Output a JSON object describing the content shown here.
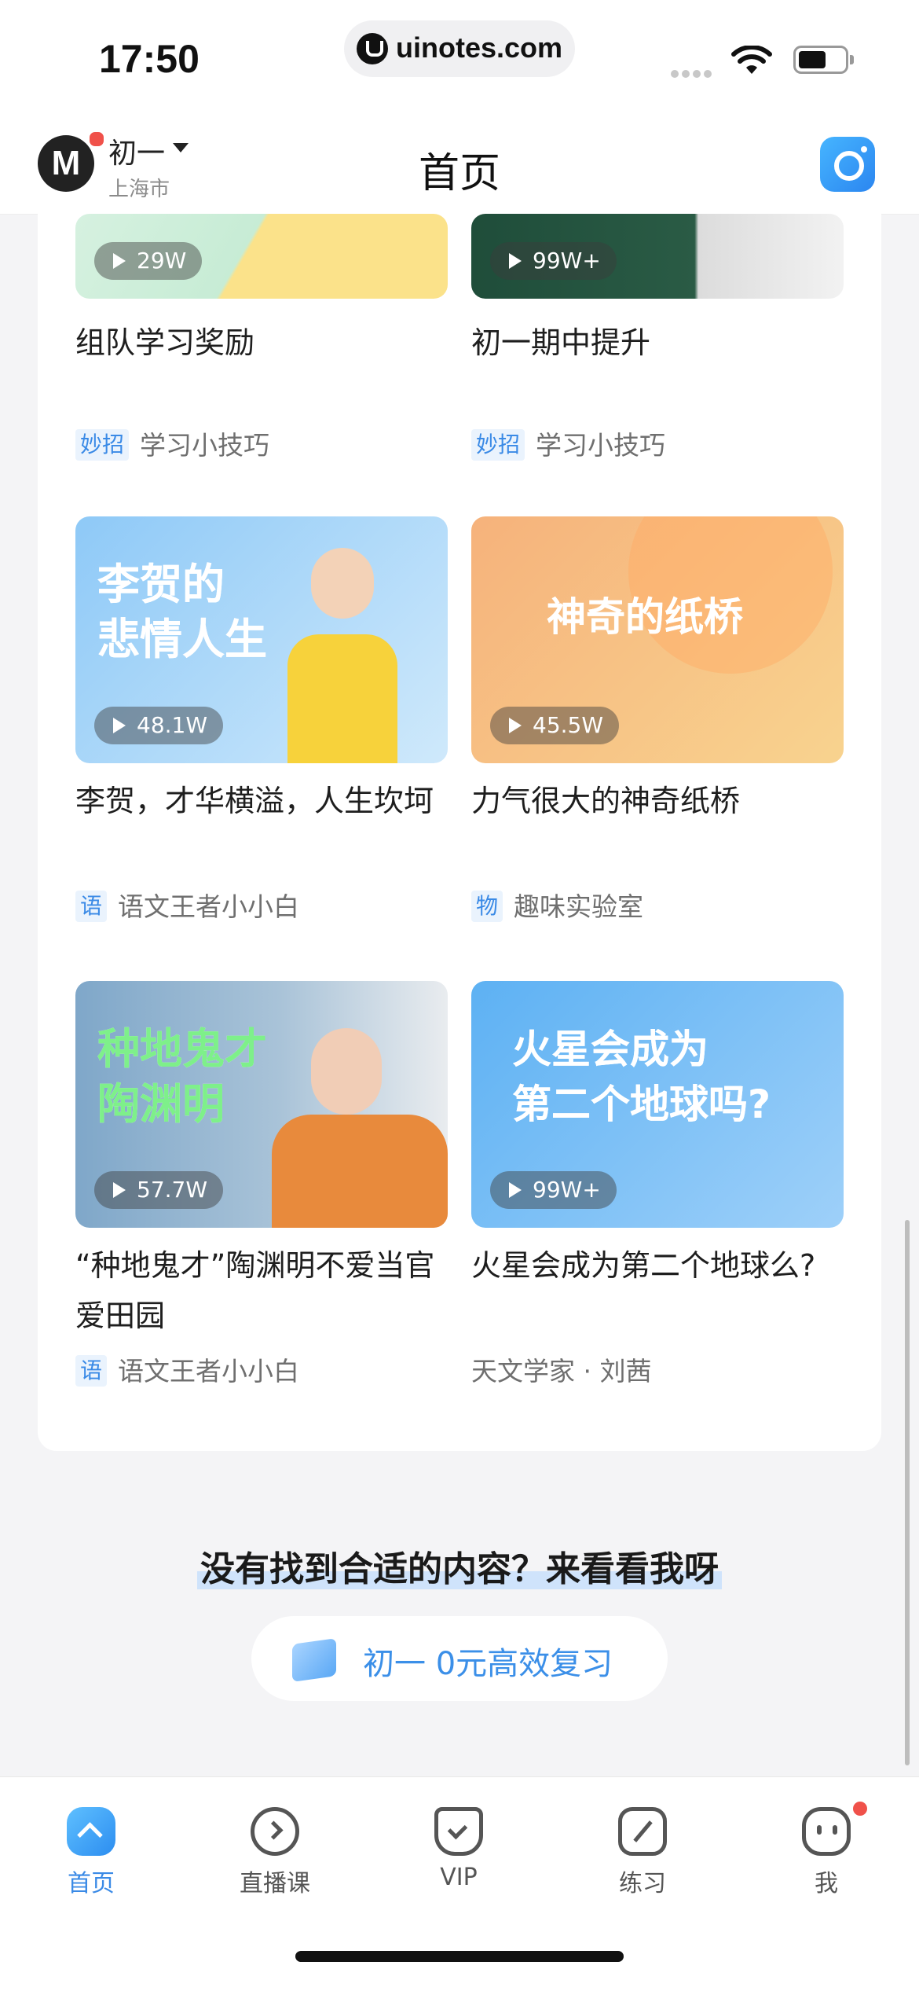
{
  "status_bar": {
    "time": "17:50",
    "url": "uinotes.com"
  },
  "header": {
    "logo_text": "M",
    "grade": "初一",
    "city": "上海市",
    "title": "首页"
  },
  "cards": [
    {
      "views": "29W",
      "title": "组队学习奖励",
      "tag": "妙招",
      "source": "学习小技巧",
      "bg1": "#d6f1e0",
      "bg2": "#fbe28a"
    },
    {
      "views": "99W+",
      "title": "初一期中提升",
      "tag": "妙招",
      "source": "学习小技巧",
      "bg1": "#1f4d3a",
      "bg2": "#e6e6e6"
    },
    {
      "views": "48.1W",
      "title": "李贺，才华横溢，人生坎坷",
      "tag": "语",
      "source": "语文王者小小白",
      "overlay": "李贺的\n悲情人生",
      "bg1": "#8ec9f7",
      "bg2": "#cfe9fb"
    },
    {
      "views": "45.5W",
      "title": "力气很大的神奇纸桥",
      "tag": "物",
      "source": "趣味实验室",
      "overlay": "神奇的纸桥",
      "bg1": "#f6b27b",
      "bg2": "#f8d38f"
    },
    {
      "views": "57.7W",
      "title": "“种地鬼才”陶渊明不爱当官爱田园",
      "tag": "语",
      "source": "语文王者小小白",
      "overlay": "种地鬼才\n陶渊明",
      "bg1": "#7fa7c9",
      "bg2": "#e88a3c"
    },
    {
      "views": "99W+",
      "title": "火星会成为第二个地球么?",
      "tag": "",
      "source": "天文学家 · 刘茜",
      "overlay": "火星会成为\n第二个地球吗?",
      "bg1": "#5db1f3",
      "bg2": "#9ed0f9"
    }
  ],
  "promo": {
    "title": "没有找到合适的内容？来看看我呀",
    "button": "初一 0元高效复习"
  },
  "tabbar": [
    {
      "label": "首页",
      "icon": "home-icon",
      "active": true
    },
    {
      "label": "直播课",
      "icon": "live-class-icon"
    },
    {
      "label": "VIP",
      "icon": "vip-icon"
    },
    {
      "label": "练习",
      "icon": "practice-icon"
    },
    {
      "label": "我",
      "icon": "profile-icon"
    }
  ],
  "colors": {
    "accent": "#3a8ae6",
    "badge": "#f0514a"
  }
}
